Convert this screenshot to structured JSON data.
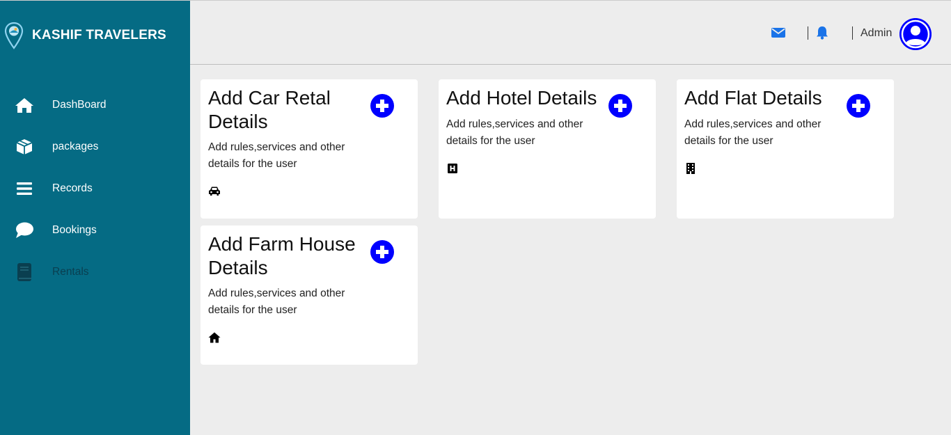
{
  "brand": {
    "name": "KASHIF TRAVELERS",
    "logo_icon": "map-pin-logo-icon"
  },
  "sidebar": {
    "items": [
      {
        "label": "DashBoard",
        "icon": "home-icon"
      },
      {
        "label": "packages",
        "icon": "box-icon"
      },
      {
        "label": "Records",
        "icon": "list-icon"
      },
      {
        "label": "Bookings",
        "icon": "chat-bubble-icon"
      },
      {
        "label": "Rentals",
        "icon": "book-icon"
      }
    ]
  },
  "topbar": {
    "mail_icon": "envelope-icon",
    "bell_icon": "bell-icon",
    "user_label": "Admin",
    "avatar_icon": "user-avatar-icon"
  },
  "cards": [
    {
      "title": "Add Car Retal Details",
      "description": "Add rules,services and other details for the user",
      "icon": "car-icon"
    },
    {
      "title": "Add Hotel Details",
      "description": "Add rules,services and other details for the user",
      "icon": "hotel-h-icon"
    },
    {
      "title": "Add Flat Details",
      "description": "Add rules,services and other details for the user",
      "icon": "building-icon"
    },
    {
      "title": "Add Farm House Details",
      "description": "Add rules,services and other details for the user",
      "icon": "home-icon"
    }
  ],
  "colors": {
    "sidebar_bg": "#056b84",
    "accent_blue": "#0000ff",
    "topbar_icon_blue": "#1a73e8",
    "page_bg": "#ededed"
  }
}
